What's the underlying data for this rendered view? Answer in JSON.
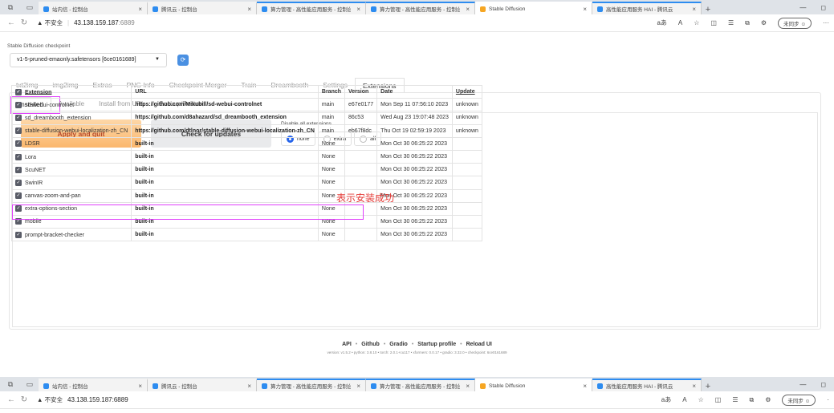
{
  "browser": {
    "tabs": [
      {
        "label": "站内信 - 控制台",
        "color": "#2d8cf0",
        "blue": false
      },
      {
        "label": "腾讯云 - 控制台",
        "color": "#2d8cf0",
        "blue": false
      },
      {
        "label": "算力管理 - 高性能应用服务 - 控制台",
        "color": "#2d8cf0",
        "blue": true
      },
      {
        "label": "算力管理 - 高性能应用服务 - 控制台",
        "color": "#2d8cf0",
        "blue": true
      },
      {
        "label": "Stable Diffusion",
        "color": "#f6a623",
        "blue": false,
        "active": true
      },
      {
        "label": "高性能应用服务 HAI - 腾讯云",
        "color": "#2d8cf0",
        "blue": true
      }
    ],
    "new_tab": "+",
    "insecure": "▲ 不安全",
    "url_host": "43.138.159.187",
    "url_port": ":6889",
    "sync_label": "未同步"
  },
  "browser2": {
    "insecure": "▲ 不安全",
    "url": "43.138.159.187:6889"
  },
  "checkpoint": {
    "label": "Stable Diffusion checkpoint",
    "value": "v1-5-pruned-emaonly.safetensors [6ce0161689]"
  },
  "main_tabs": [
    "txt2img",
    "img2img",
    "Extras",
    "PNG Info",
    "Checkpoint Merger",
    "Train",
    "Dreambooth",
    "Settings",
    "Extensions"
  ],
  "active_main_tab": "Extensions",
  "sub_tabs": [
    "Installed",
    "Available",
    "Install from URL",
    "Backup/Restore"
  ],
  "apply_button": "Apply and quit",
  "check_button": "Check for updates",
  "disable_label": "Disable all extensions",
  "radio_options": [
    "none",
    "extra",
    "all"
  ],
  "selected_radio": "none",
  "table": {
    "headers": [
      "Extension",
      "URL",
      "Branch",
      "Version",
      "Date",
      "Update"
    ],
    "rows": [
      [
        "sd-webui-controlnet",
        "https://github.com/Mikubill/sd-webui-controlnet",
        "main",
        "e67e0177",
        "Mon Sep 11 07:56:10 2023",
        "unknown"
      ],
      [
        "sd_dreambooth_extension",
        "https://github.com/d8ahazard/sd_dreambooth_extension",
        "main",
        "86c53",
        "Wed Aug 23 19:07:48 2023",
        "unknown"
      ],
      [
        "stable-diffusion-webui-localization-zh_CN",
        "https://github.com/dtlnor/stable-diffusion-webui-localization-zh_CN",
        "main",
        "eb67f8dc",
        "Thu Oct 19 02:59:19 2023",
        "unknown"
      ],
      [
        "LDSR",
        "built-in",
        "None",
        "",
        "Mon Oct 30 06:25:22 2023",
        ""
      ],
      [
        "Lora",
        "built-in",
        "None",
        "",
        "Mon Oct 30 06:25:22 2023",
        ""
      ],
      [
        "ScuNET",
        "built-in",
        "None",
        "",
        "Mon Oct 30 06:25:22 2023",
        ""
      ],
      [
        "SwinIR",
        "built-in",
        "None",
        "",
        "Mon Oct 30 06:25:22 2023",
        ""
      ],
      [
        "canvas-zoom-and-pan",
        "built-in",
        "None",
        "",
        "Mon Oct 30 06:25:22 2023",
        ""
      ],
      [
        "extra-options-section",
        "built-in",
        "None",
        "",
        "Mon Oct 30 06:25:22 2023",
        ""
      ],
      [
        "mobile",
        "built-in",
        "None",
        "",
        "Mon Oct 30 06:25:22 2023",
        ""
      ],
      [
        "prompt-bracket-checker",
        "built-in",
        "None",
        "",
        "Mon Oct 30 06:25:22 2023",
        ""
      ]
    ]
  },
  "annotation": "表示安装成功",
  "footer": {
    "links": [
      "API",
      "Github",
      "Gradio",
      "Startup profile",
      "Reload UI"
    ],
    "separator": "•",
    "version_line": "version: v1.5.2  •  python: 3.8.10  •  torch: 2.0.1+cu117  •  xformers: 0.0.17  •  gradio: 3.32.0  •  checkpoint: 6ce0161689"
  },
  "colors": {
    "accent": "#2564eb",
    "highlight": "#e040fb",
    "annotation": "#e53935",
    "apply_bg": "#fbb76d"
  }
}
